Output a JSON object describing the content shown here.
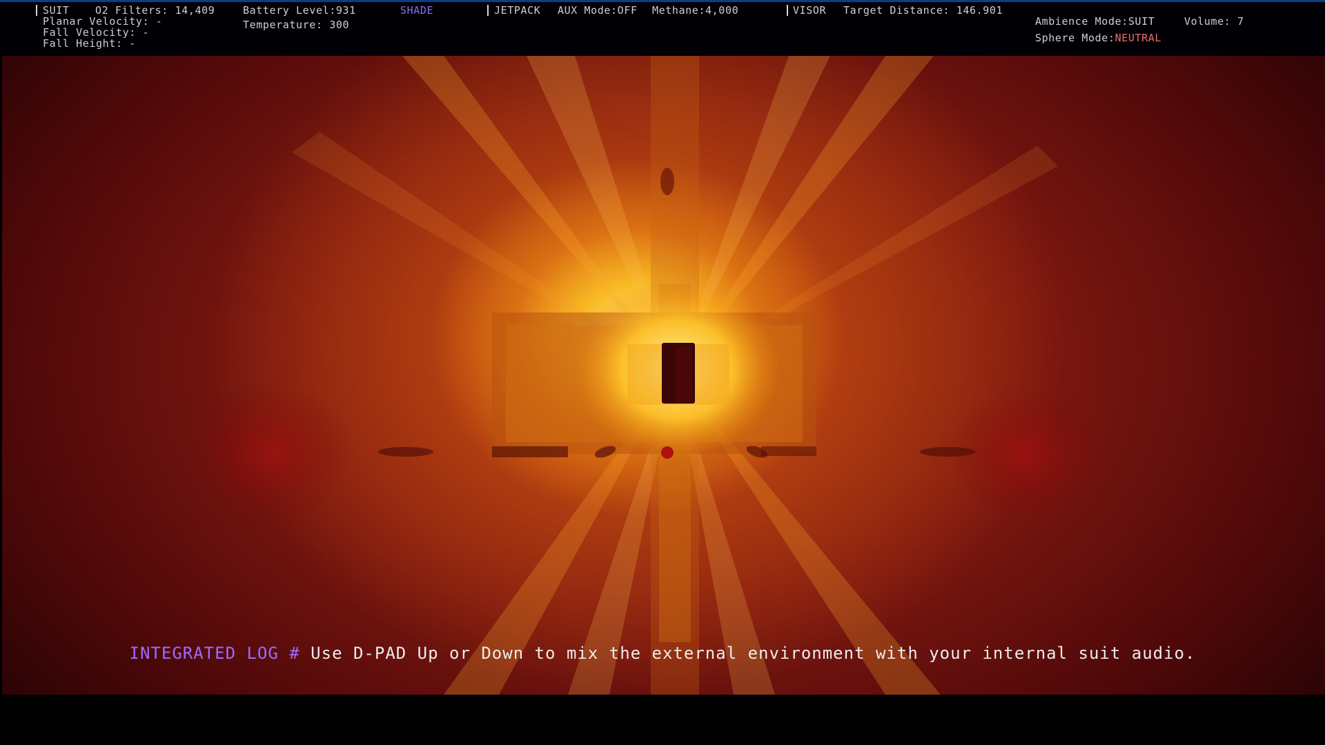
{
  "hud": {
    "suit": {
      "label": "SUIT",
      "o2_filters": "O2 Filters: 14,409",
      "planar_velocity": "Planar Velocity: -",
      "fall_velocity": "Fall Velocity: -",
      "fall_height": "Fall Height: -",
      "battery_level": "Battery Level:931",
      "temperature": "Temperature: 300",
      "shade": "SHADE"
    },
    "jetpack": {
      "label": "JETPACK",
      "aux_mode": "AUX Mode:OFF",
      "methane": "Methane:4,000"
    },
    "visor": {
      "label": "VISOR",
      "target_distance": "Target Distance: 146.901"
    },
    "audio": {
      "ambience_mode": "Ambience Mode:SUIT",
      "volume": "Volume: 7",
      "sphere_mode_label": "Sphere Mode:",
      "sphere_mode_value": "NEUTRAL"
    }
  },
  "log": {
    "prefix": "INTEGRATED LOG # ",
    "message": "Use D-PAD Up or Down to mix the external environment with your internal suit audio."
  },
  "colors": {
    "hud_text": "#cfd0d3",
    "neutral_accent": "#ea6f6f",
    "shade_accent": "#8a6df0",
    "log_prefix": "#9b6cff",
    "top_border": "#0e3d86"
  }
}
